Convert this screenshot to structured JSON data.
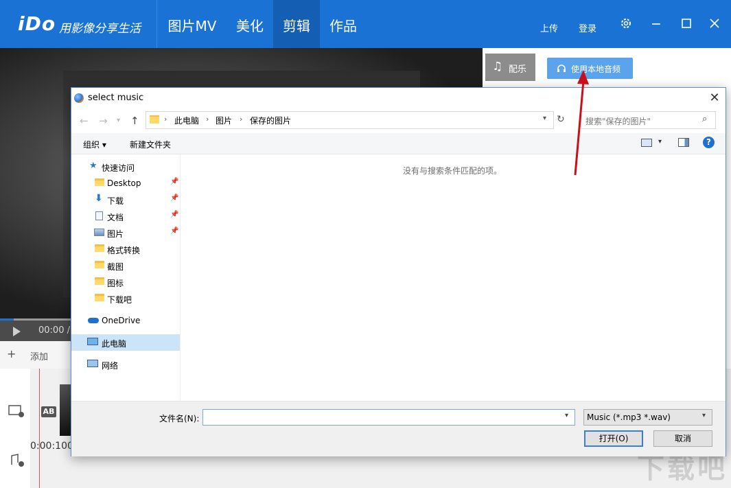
{
  "app": {
    "logo": "iDo",
    "slogan": "用影像分享生活",
    "nav_tabs": [
      {
        "label": "图片MV"
      },
      {
        "label": "美化"
      },
      {
        "label": "剪辑"
      },
      {
        "label": "作品"
      }
    ],
    "upload_label": "上传",
    "login_label": "登录",
    "brand_color": "#1a73d4"
  },
  "player": {
    "time": "00:00 /",
    "add_label": "添加"
  },
  "timeline": {
    "ab_badge": "AB",
    "time_label": "0:00:100"
  },
  "music_panel": {
    "tab_label": "配乐",
    "local_audio_button": "使用本地音频"
  },
  "watermark": "下载吧",
  "dialog": {
    "title": "select music",
    "breadcrumb": [
      "此电脑",
      "图片",
      "保存的图片"
    ],
    "search_placeholder": "搜索\"保存的图片\"",
    "toolbar": {
      "organize": "组织 ▾",
      "new_folder": "新建文件夹"
    },
    "nav": {
      "quick_access": "快速访问",
      "items": [
        {
          "label": "Desktop",
          "icon": "folder-icon",
          "pinned": true
        },
        {
          "label": "下载",
          "icon": "download-icon",
          "pinned": true
        },
        {
          "label": "文档",
          "icon": "document-icon",
          "pinned": true
        },
        {
          "label": "图片",
          "icon": "picture-icon",
          "pinned": true
        },
        {
          "label": "格式转换",
          "icon": "folder-icon",
          "pinned": false
        },
        {
          "label": "截图",
          "icon": "folder-icon",
          "pinned": false
        },
        {
          "label": "图标",
          "icon": "folder-icon",
          "pinned": false
        },
        {
          "label": "下载吧",
          "icon": "folder-icon",
          "pinned": false
        }
      ],
      "onedrive": "OneDrive",
      "this_pc": "此电脑",
      "network": "网络"
    },
    "empty_message": "没有与搜索条件匹配的项。",
    "filename_label": "文件名(N):",
    "filename_value": "",
    "file_filter": "Music (*.mp3 *.wav)",
    "open_button": "打开(O)",
    "cancel_button": "取消"
  }
}
